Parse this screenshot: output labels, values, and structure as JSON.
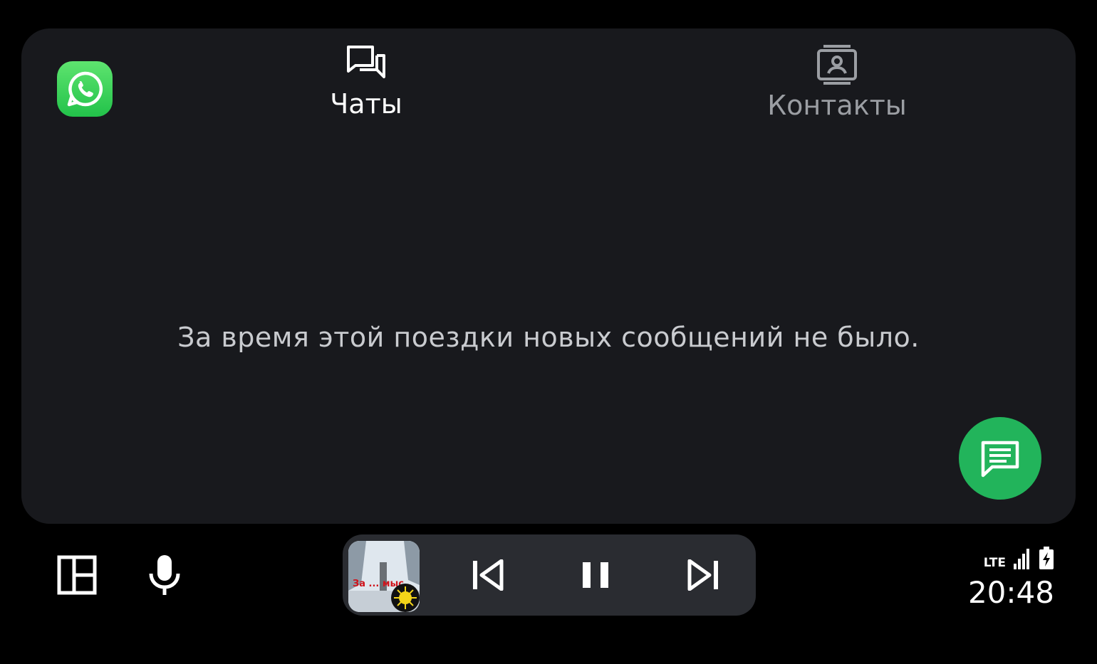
{
  "app": {
    "name": "WhatsApp",
    "icon": "whatsapp-icon",
    "brand_color": "#25D366"
  },
  "tabs": [
    {
      "label": "Чаты",
      "icon": "chats-icon",
      "active": true
    },
    {
      "label": "Контакты",
      "icon": "contacts-icon",
      "active": false
    }
  ],
  "empty_state": {
    "message": "За время этой поездки новых сообщений не было."
  },
  "fab": {
    "icon": "new-message-icon",
    "color": "#22B45B"
  },
  "rail": {
    "dashboard_icon": "dashboard-layout-icon",
    "mic_icon": "microphone-icon"
  },
  "media": {
    "album_art_label": "За ... мыс",
    "controls": [
      "skip-previous-icon",
      "pause-icon",
      "skip-next-icon"
    ]
  },
  "status": {
    "network": "LTE",
    "time": "20:48"
  },
  "colors": {
    "background": "#000000",
    "card": "#18191D",
    "media_bar": "#2A2C31",
    "active_text": "#FFFFFF",
    "inactive_text": "#9B9EA3"
  }
}
